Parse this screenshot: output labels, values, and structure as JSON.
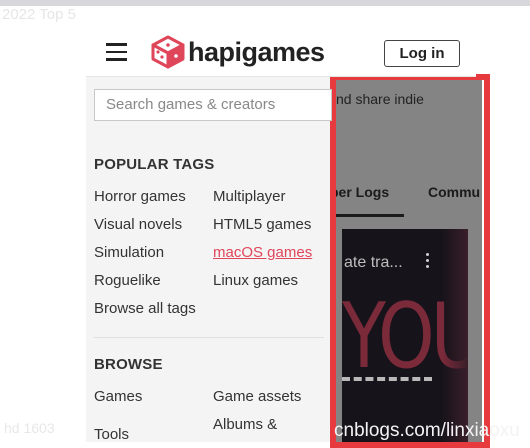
{
  "background": {
    "faded_top_text": "2022 Top 5",
    "watermark_left": "hd 1603",
    "watermark_right": "cnblogs.com/linxiaoxu",
    "page_text": "nd share indie",
    "page_tabs": [
      "per Logs",
      "Commu"
    ],
    "video_title": "ate tra...",
    "video_art_text": "YOU"
  },
  "header": {
    "logo_text": "hapigames",
    "login_label": "Log in"
  },
  "menu": {
    "search_placeholder": "Search games & creators",
    "popular_tags_title": "POPULAR TAGS",
    "tags_left": [
      "Horror games",
      "Visual novels",
      "Simulation",
      "Roguelike",
      "Browse all tags"
    ],
    "tags_right": [
      "Multiplayer",
      "HTML5 games",
      "macOS games",
      "Linux games"
    ],
    "browse_title": "BROWSE",
    "browse_left": [
      "Games",
      "Tools"
    ],
    "browse_right": [
      "Game assets",
      "Albums &"
    ]
  },
  "colors": {
    "highlight": "#e63a3e",
    "link": "#e0465a"
  }
}
